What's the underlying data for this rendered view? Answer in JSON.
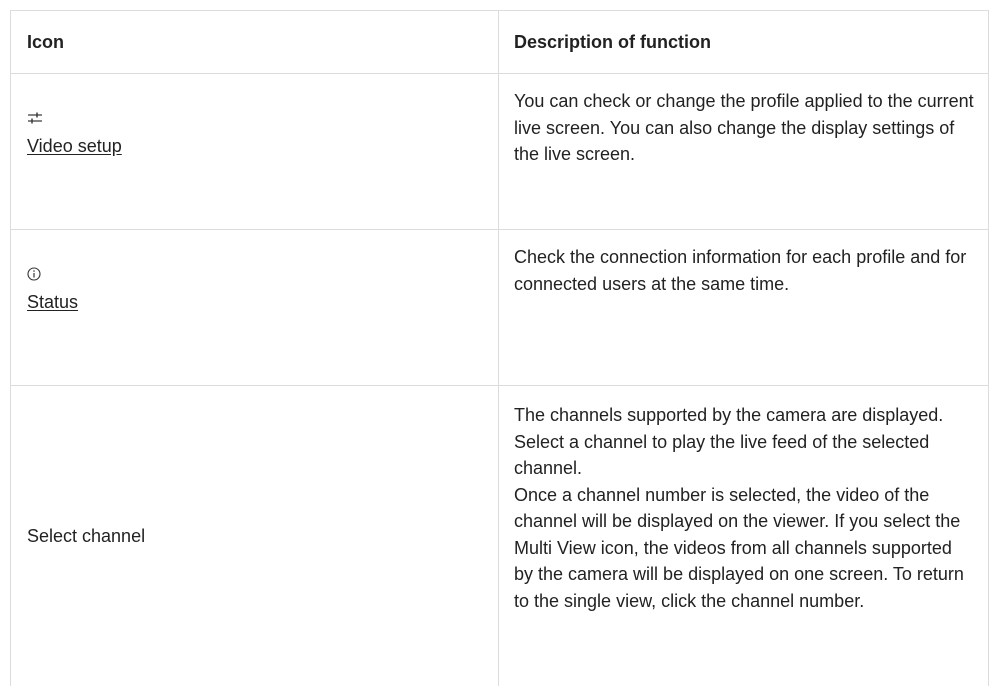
{
  "table": {
    "headers": {
      "icon": "Icon",
      "description": "Description of function"
    },
    "rows": [
      {
        "icon": "sliders-icon",
        "link": "Video setup",
        "description": "You can check or change the profile applied to the current live screen. You can also change the display settings of the live screen."
      },
      {
        "icon": "info-icon",
        "link": "Status",
        "description": "Check the connection information for each profile and for connected users at the same time."
      },
      {
        "label": "Select channel",
        "description_1": "The channels supported by the camera are displayed. Select a channel to play the live feed of the selected channel.",
        "description_2": "Once a channel number is selected, the video of the channel will be displayed on the viewer. If you select the Multi View icon, the videos from all channels supported by the camera will be displayed on one screen. To return to the single view, click the channel number."
      }
    ]
  }
}
